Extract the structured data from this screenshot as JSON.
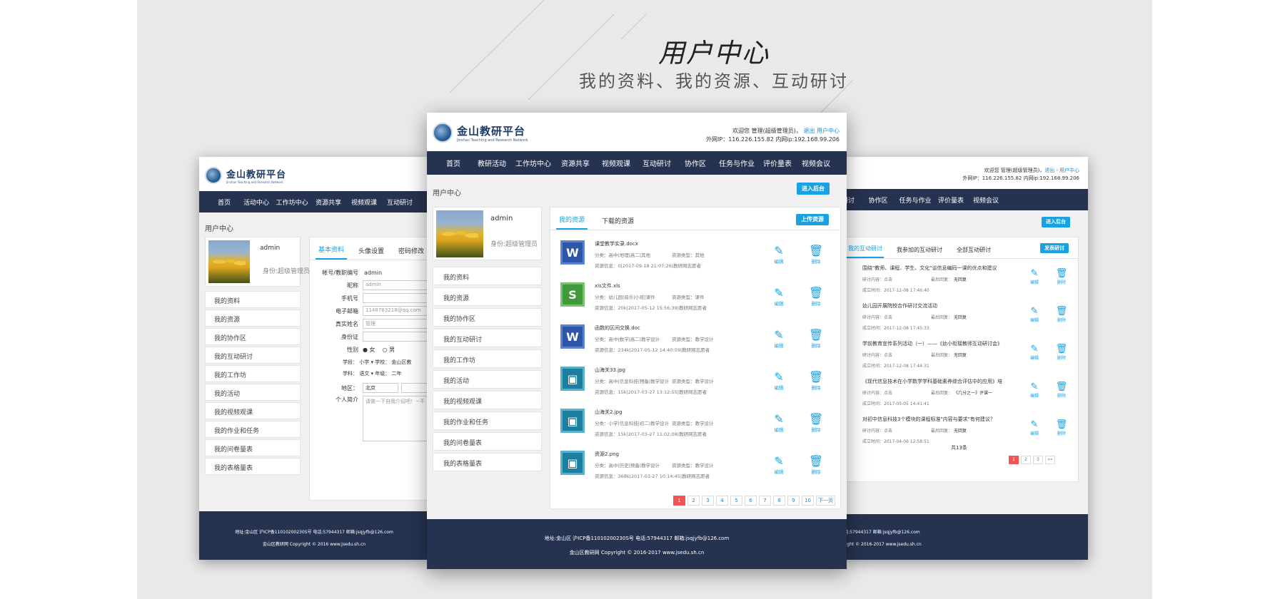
{
  "hero": {
    "title": "用户中心",
    "subtitle": "我的资料、我的资源、互动研讨"
  },
  "site": {
    "name": "金山教研平台",
    "name_en": "Jinshan Teaching and Research Network"
  },
  "user_bar": {
    "welcome": "欢迎您 管理(超级管理员)，",
    "logout": "退出",
    "user_center": "用户中心",
    "ip_line": "外网IP：116.226.155.82 内网ip:192.168.99.206"
  },
  "nav": {
    "items": [
      "首页",
      "教研活动",
      "工作坊中心",
      "资源共享",
      "视频观课",
      "互动研讨",
      "协作区",
      "任务与作业",
      "评价量表",
      "视频会议"
    ],
    "left_items": [
      "首页",
      "活动中心",
      "工作坊中心",
      "资源共享",
      "视频观课",
      "互动研讨"
    ]
  },
  "page": {
    "label": "用户中心",
    "admin_button": "进入后台"
  },
  "profile": {
    "name": "admin",
    "role": "身份:超级管理员"
  },
  "menu": [
    "我的资料",
    "我的资源",
    "我的协作区",
    "我的互动研讨",
    "我的工作坊",
    "我的活动",
    "我的视频观课",
    "我的作业和任务",
    "我的问卷量表",
    "我的表格量表"
  ],
  "form": {
    "tabs": [
      "基本资料",
      "头像设置",
      "密码修改"
    ],
    "rows": [
      {
        "label": "帐号/教职编号",
        "value": "admin"
      },
      {
        "label": "昵称",
        "value": "admin"
      },
      {
        "label": "手机号",
        "value": ""
      },
      {
        "label": "电子邮箱",
        "value": "1148783218@qq.com"
      },
      {
        "label": "真实姓名",
        "value": "管理"
      },
      {
        "label": "身份证",
        "value": ""
      }
    ],
    "gender_label": "性别",
    "gender_female": "女",
    "gender_male": "男",
    "school_line": "学段： 小学 ▾ 学校： 金山区教",
    "subject_line": "学科： 语文 ▾ 年级： 二年",
    "region_label": "地区：",
    "region_value": "北京",
    "intro_label": "个人简介",
    "intro_placeholder": "请做一下自我介绍吧！~不"
  },
  "resources": {
    "tabs": [
      "我的资源",
      "下载的资源"
    ],
    "upload_button": "上传资源",
    "edit_label": "编辑",
    "delete_label": "删除",
    "items": [
      {
        "icon": "W",
        "type": "word",
        "name": "课堂教学实录.docx",
        "category": "分类：高中|地理|高二|其他",
        "restype": "资源类型：其他",
        "info": "资源信息：0|2017-09-18 21:07:26|教研网志愿者"
      },
      {
        "icon": "S",
        "type": "excel",
        "name": "xls文件.xls",
        "category": "分类：幼儿园|音乐|小班|课件",
        "restype": "资源类型：课件",
        "info": "资源信息：20k|2017-05-12 15:56:39|教研网志愿者"
      },
      {
        "icon": "W",
        "type": "word",
        "name": "函数的区间交换.doc",
        "category": "分类：高中|数学|高二|教学设计",
        "restype": "资源类型：教学设计",
        "info": "资源信息：234k|2017-05-12 14:40:59|教研网志愿者"
      },
      {
        "icon": "▣",
        "type": "image",
        "name": "山海关33.jpg",
        "category": "分类：高中|信息科技|预备|教学设计",
        "restype": "资源类型：教学设计",
        "info": "资源信息：15k|2017-03-27 13:12:55|教研网志愿者"
      },
      {
        "icon": "▣",
        "type": "image",
        "name": "山海关2.jpg",
        "category": "分类：小学|信息科技|初二|教学设计",
        "restype": "资源类型：教学设计",
        "info": "资源信息：15k|2017-03-27 11:02:08|教研网志愿者"
      },
      {
        "icon": "▣",
        "type": "image",
        "name": "资源2.png",
        "category": "分类：高中|历史|预备|教学设计",
        "restype": "资源类型：教学设计",
        "info": "资源信息：368k|2017-03-27 10:14:45|教研网志愿者"
      }
    ],
    "pager": [
      "1",
      "2",
      "3",
      "4",
      "5",
      "6",
      "7",
      "8",
      "9",
      "10",
      "下一页"
    ]
  },
  "discussion": {
    "tabs": [
      "我的互动研讨",
      "我参加的互动研讨",
      "全部互动研讨"
    ],
    "post_button": "发表研讨",
    "edit_label": "编辑",
    "delete_label": "删除",
    "items": [
      {
        "title": "围绕\"教师、课程、学生、文化\"谈信息编码一课的优点和建议",
        "content": "研讨内容：点击",
        "reply": "最后回复：",
        "reply_val": "无回复",
        "time": "成立时间：2017-12-08 17:46:40"
      },
      {
        "title": "幼儿园开展院校合作研讨交流活动",
        "content": "研讨内容：点击",
        "reply": "最后回复：",
        "reply_val": "无回复",
        "time": "成立时间：2017-12-08 17:45:33"
      },
      {
        "title": "学前教育宣传系列活动（一）——《幼小衔接教师互动研讨会》",
        "content": "研讨内容：点击",
        "reply": "最后回复：",
        "reply_val": "无回复",
        "time": "成立时间：2017-12-08 17:44:31"
      },
      {
        "title": "《现代信息技术在小学数学学科基础素养综合评估中的应用》培",
        "content": "研讨内容：点击",
        "reply": "最后回复：",
        "reply_val": "《几分之一》评课一",
        "time": "成立时间：2017-05-05 14:41:41"
      },
      {
        "title": "对初中信息科技3个模块的课程标准\"内容与要求\"有何建议？",
        "content": "研讨内容：点击",
        "reply": "最后回复：",
        "reply_val": "无回复",
        "time": "成立时间：2017-04-06 12:58:51"
      }
    ],
    "total": "共13条",
    "pager": [
      "1",
      "2",
      "3",
      "»»"
    ]
  },
  "footer": {
    "line1": "地址:金山区  沪ICP备11010200230S号 电话:57944317 邮箱:jsqjyfb@126.com",
    "line2": "金山区教研网 Copyright © 2016-2017 www.jsedu.sh.cn",
    "line2_left": "金山区教研网 Copyright © 2016 www.jsedu.sh.cn"
  },
  "colors": {
    "nav": "#263350",
    "accent": "#1aa1e1",
    "page_current": "#ee5555"
  }
}
